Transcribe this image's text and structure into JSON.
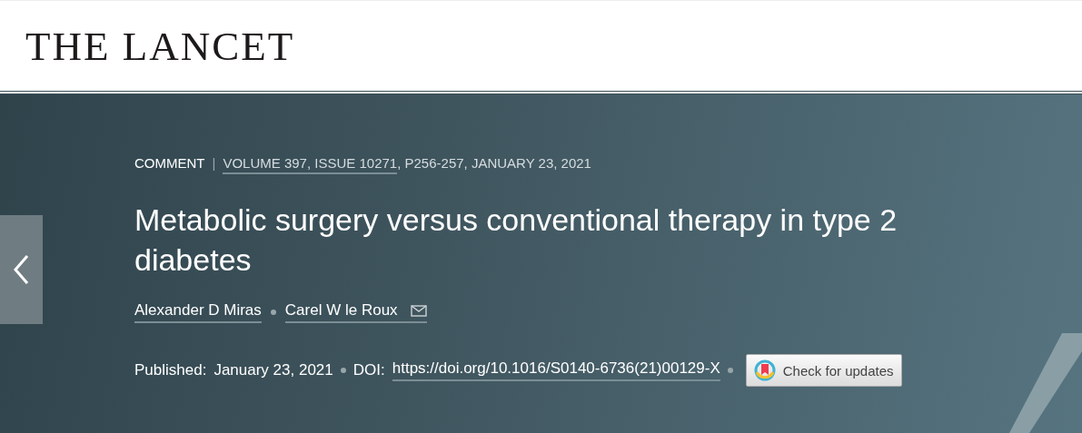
{
  "logo": "THE LANCET",
  "article": {
    "type": "COMMENT",
    "separator": "|",
    "issue_link": "VOLUME 397, ISSUE 10271",
    "citation_rest": ", P256-257, JANUARY 23, 2021",
    "title": "Metabolic surgery versus conventional therapy in type 2 diabetes",
    "authors": [
      {
        "name": "Alexander D Miras",
        "email": false
      },
      {
        "name": "Carel W le Roux",
        "email": true
      }
    ],
    "published_label": "Published:",
    "published_date": "January 23, 2021",
    "doi_label": "DOI:",
    "doi": "https://doi.org/10.1016/S0140-6736(21)00129-X",
    "update_button": "Check for updates"
  }
}
